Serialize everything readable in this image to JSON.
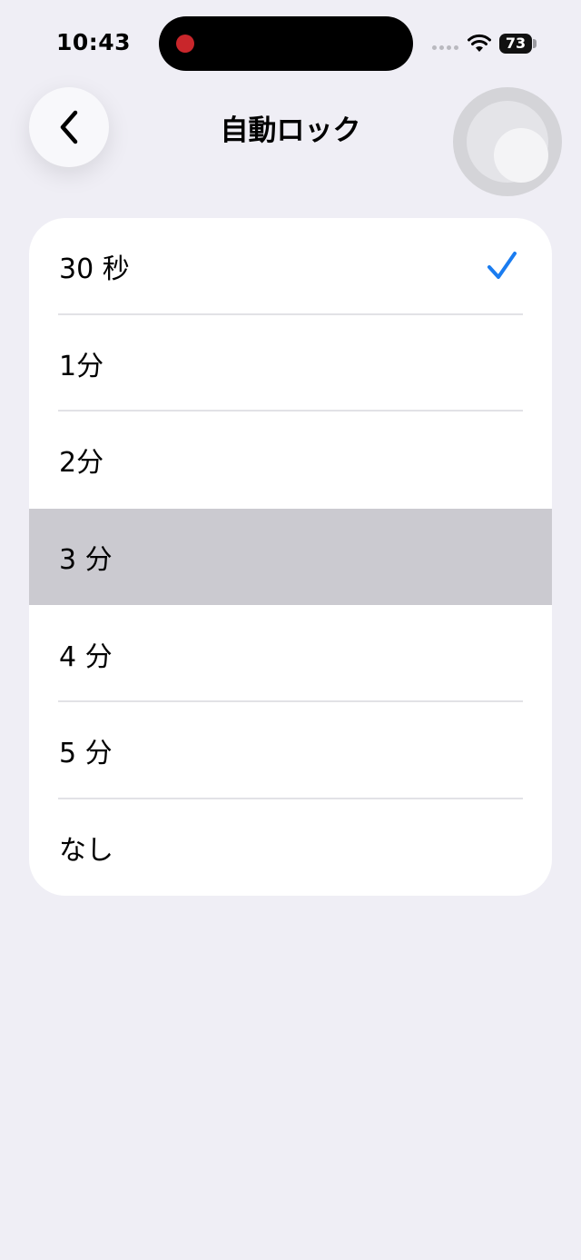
{
  "status_bar": {
    "time": "10:43",
    "battery": "73"
  },
  "nav": {
    "title": "自動ロック"
  },
  "options": [
    {
      "label": "30 秒",
      "selected": true
    },
    {
      "label": "1分",
      "selected": false
    },
    {
      "label": "2分",
      "selected": false
    },
    {
      "label": "3 分",
      "selected": false
    },
    {
      "label": "4 分",
      "selected": false
    },
    {
      "label": "5 分",
      "selected": false
    },
    {
      "label": "なし",
      "selected": false
    }
  ],
  "colors": {
    "background": "#efeef5",
    "accent": "#1a7cf0",
    "highlight_row": "#cbcad0",
    "recording_dot": "#c9262b"
  }
}
